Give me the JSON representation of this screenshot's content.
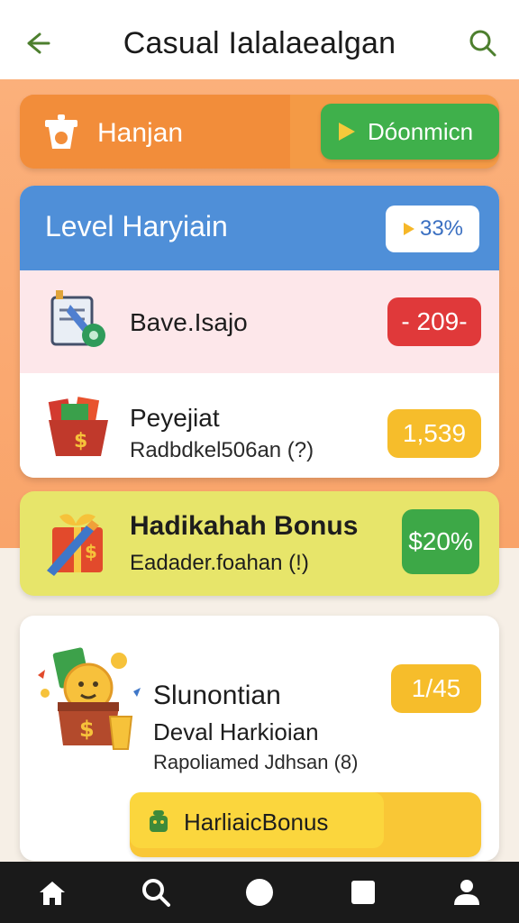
{
  "header": {
    "title": "Casual Ialalaealgan"
  },
  "topbar": {
    "label": "Hanjan",
    "button_label": "Dóonmicn"
  },
  "level": {
    "title": "Level Haryiain",
    "percent": "33%",
    "rows": [
      {
        "title": "Bave.Isajo",
        "subtitle": "",
        "value": "- 209-"
      },
      {
        "title": "Peyejiat",
        "subtitle": "Radbdkel506an (?)",
        "value": "1,539"
      }
    ]
  },
  "bonus": {
    "title": "Hadikahah Bonus",
    "subtitle": "Eadader.foahan (!)",
    "value": "$20%"
  },
  "reward": {
    "title": "Slunontian",
    "subtitle": "Deval Harkioian",
    "detail": "Rapoliamed Jdhsan (8)",
    "value": "1/45",
    "button_label": "HarliaicBonus"
  },
  "nav": {
    "items": [
      "home-icon",
      "search-icon",
      "circle-icon",
      "square-icon",
      "profile-icon"
    ]
  },
  "colors": {
    "orange": "#f49a45",
    "blue": "#4f8fd8",
    "green": "#3fb04b",
    "red": "#e0393a",
    "yellow": "#f6bd2b"
  }
}
